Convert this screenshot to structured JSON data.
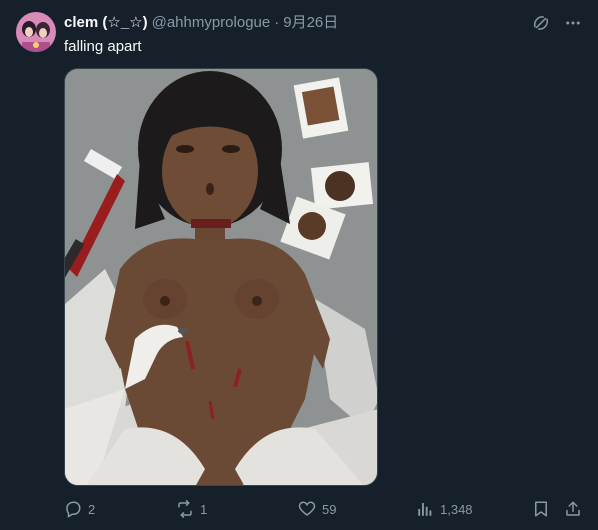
{
  "author": {
    "display_name": "clem (☆_☆)",
    "handle": "@ahhmyprologue",
    "date": "9月26日"
  },
  "tweet": {
    "text": "falling apart"
  },
  "actions": {
    "replies": "2",
    "retweets": "1",
    "likes": "59",
    "views": "1,348"
  },
  "icons": [
    "grok-icon",
    "more-icon",
    "reply-icon",
    "retweet-icon",
    "like-icon",
    "views-icon",
    "bookmark-icon",
    "share-icon"
  ],
  "colors": {
    "background": "#15202b",
    "secondary_text": "#8b98a5",
    "primary_text": "#f7f9f9"
  }
}
